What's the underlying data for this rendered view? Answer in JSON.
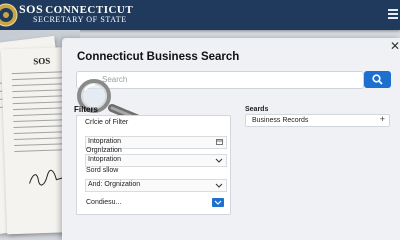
{
  "header": {
    "logo_text": "SOS",
    "title": "CONNECTICUT",
    "subtitle": "SECRETARY OF STATE",
    "menu_icon": "hamburger-icon",
    "bar_color": "#1f3a5c"
  },
  "background_document": {
    "heading": "SOS",
    "icon": "document-stack"
  },
  "panel": {
    "title": "Connecticut Business Search",
    "close_icon": "close-icon",
    "search": {
      "placeholder": "Search",
      "value": "",
      "button_icon": "search-icon",
      "button_color": "#1e6fcf"
    }
  },
  "filters": {
    "title": "Filters",
    "criteria_label": "Crlcie of Filter",
    "field_1_value": "Intopration",
    "organization_label": "Orgnlzation",
    "field_2_value": "Intopration",
    "sort_label": "Sord sllow",
    "field_3_value": "And: Orgnization",
    "checkbox_label": "Condiesu...",
    "checkbox_checked": true
  },
  "searches": {
    "title": "Seards",
    "items": [
      {
        "label": "Business Records",
        "action_icon": "plus-icon"
      }
    ]
  }
}
